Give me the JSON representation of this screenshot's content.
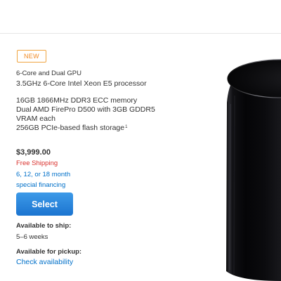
{
  "product": {
    "badge": "NEW",
    "config_title": "6-Core and Dual GPU",
    "processor": "3.5GHz 6-Core Intel Xeon E5 processor",
    "memory": "16GB 1866MHz DDR3 ECC memory",
    "graphics_line1": "Dual AMD FirePro D500 with 3GB GDDR5",
    "graphics_line2": "VRAM each",
    "storage": "256GB PCIe-based flash storage",
    "storage_footnote": "1",
    "price": "$3,999.00",
    "shipping": "Free Shipping",
    "financing_line1": "6, 12, or 18 month",
    "financing_line2": "special financing",
    "select_label": "Select",
    "ship_label": "Available to ship:",
    "ship_value": "5–6 weeks",
    "pickup_label": "Available for pickup:",
    "pickup_link": "Check availability"
  },
  "colors": {
    "badge_orange": "#f08a24",
    "shipping_red": "#d9302c",
    "link_blue": "#0070c9",
    "button_blue": "#2a86dd",
    "product_black": "#0d0d0f"
  },
  "image": {
    "subject": "mac-pro-cylinder"
  }
}
